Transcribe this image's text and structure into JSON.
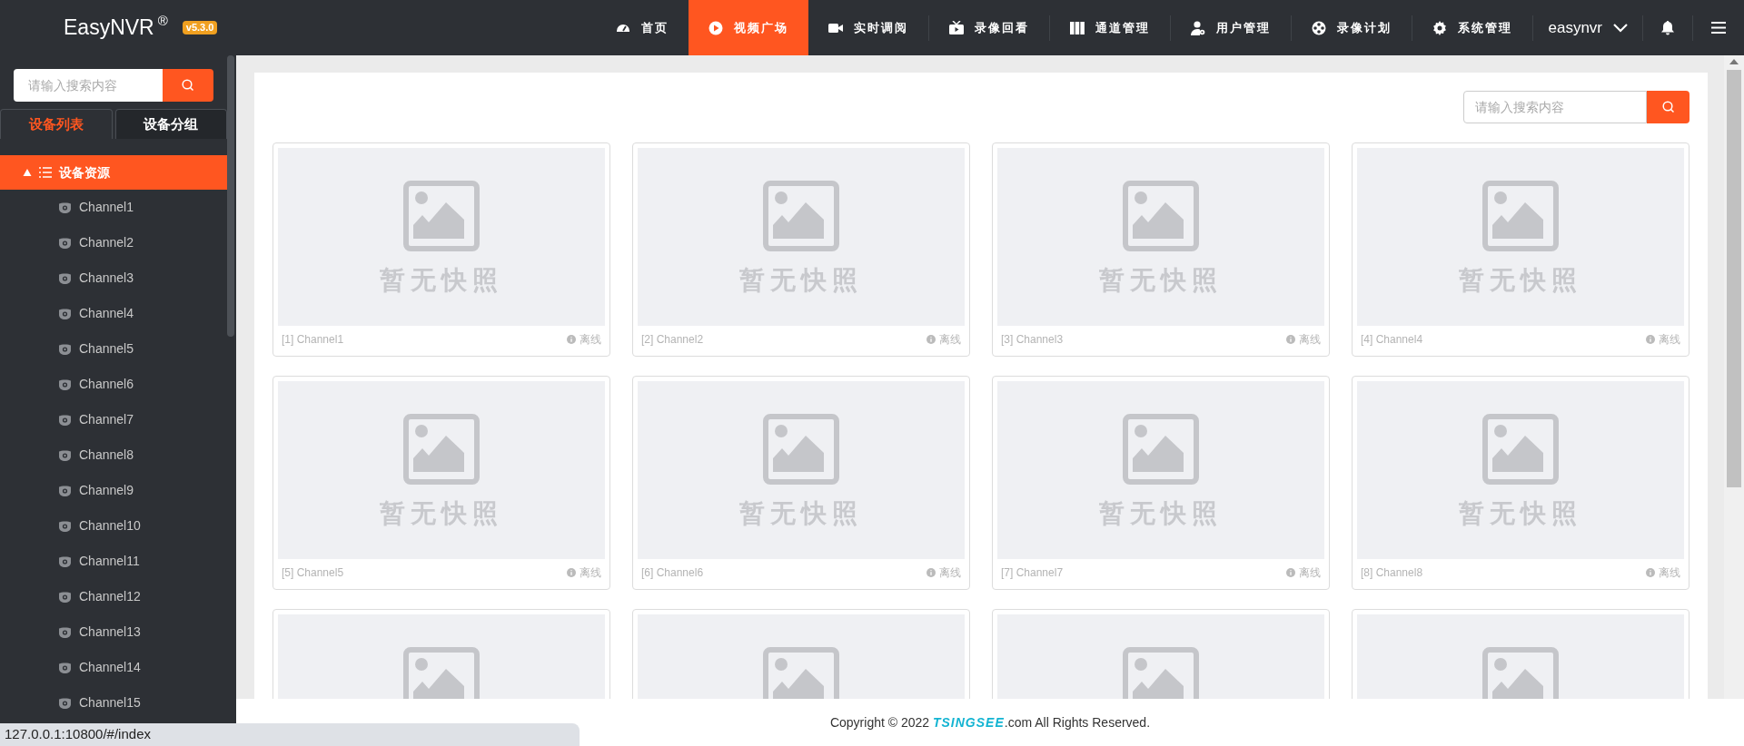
{
  "header": {
    "logo": "EasyNVR",
    "registered_mark": "®",
    "version": "v5.3.0",
    "nav": [
      {
        "label": "首页",
        "selected": false
      },
      {
        "label": "视频广场",
        "selected": true
      },
      {
        "label": "实时调阅",
        "selected": false
      },
      {
        "label": "录像回看",
        "selected": false
      },
      {
        "label": "通道管理",
        "selected": false
      },
      {
        "label": "用户管理",
        "selected": false
      },
      {
        "label": "录像计划",
        "selected": false
      },
      {
        "label": "系统管理",
        "selected": false
      }
    ],
    "user": "easynvr"
  },
  "sidebar": {
    "search": {
      "placeholder": "请输入搜索内容"
    },
    "tabs": [
      {
        "label": "设备列表",
        "selected": true
      },
      {
        "label": "设备分组",
        "selected": false
      }
    ],
    "tree": [
      {
        "label": "设备资源",
        "selected": true,
        "expanded": true,
        "children": [
          {
            "label": "Channel1",
            "selected": false
          },
          {
            "label": "Channel2",
            "selected": false
          },
          {
            "label": "Channel3",
            "selected": false
          },
          {
            "label": "Channel4",
            "selected": false
          },
          {
            "label": "Channel5",
            "selected": false
          },
          {
            "label": "Channel6",
            "selected": false
          },
          {
            "label": "Channel7",
            "selected": false
          },
          {
            "label": "Channel8",
            "selected": false
          },
          {
            "label": "Channel9",
            "selected": false
          },
          {
            "label": "Channel10",
            "selected": false
          },
          {
            "label": "Channel11",
            "selected": false
          },
          {
            "label": "Channel12",
            "selected": false
          },
          {
            "label": "Channel13",
            "selected": false
          },
          {
            "label": "Channel14",
            "selected": false
          },
          {
            "label": "Channel15",
            "selected": false
          }
        ]
      }
    ]
  },
  "main": {
    "search": {
      "placeholder": "请输入搜索内容"
    },
    "cards": [
      {
        "kind": "full",
        "snapshot_text": "暂无快照",
        "label": "[1] Channel1",
        "status": "离线"
      },
      {
        "kind": "full",
        "snapshot_text": "暂无快照",
        "label": "[2] Channel2",
        "status": "离线"
      },
      {
        "kind": "full",
        "snapshot_text": "暂无快照",
        "label": "[3] Channel3",
        "status": "离线"
      },
      {
        "kind": "full",
        "snapshot_text": "暂无快照",
        "label": "[4] Channel4",
        "status": "离线"
      },
      {
        "kind": "full",
        "snapshot_text": "暂无快照",
        "label": "[5] Channel5",
        "status": "离线"
      },
      {
        "kind": "full",
        "snapshot_text": "暂无快照",
        "label": "[6] Channel6",
        "status": "离线"
      },
      {
        "kind": "full",
        "snapshot_text": "暂无快照",
        "label": "[7] Channel7",
        "status": "离线"
      },
      {
        "kind": "full",
        "snapshot_text": "暂无快照",
        "label": "[8] Channel8",
        "status": "离线"
      },
      {
        "kind": "partial"
      },
      {
        "kind": "partial"
      },
      {
        "kind": "partial"
      },
      {
        "kind": "partial"
      }
    ]
  },
  "footer": {
    "before": "Copyright © 2022",
    "brand": "TSINGSEE",
    "after": ".com All Rights Reserved."
  },
  "status_bar": "127.0.0.1:10800/#/index"
}
